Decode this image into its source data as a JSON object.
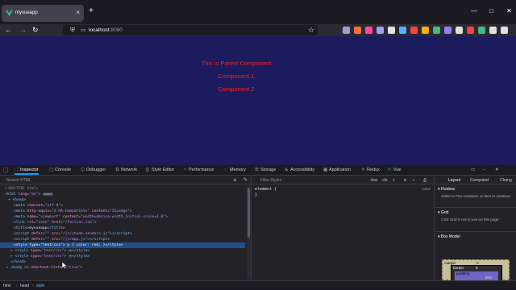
{
  "browser": {
    "tab_title": "myvueapp",
    "tab_close": "×",
    "new_tab": "+",
    "window_controls": [
      "—",
      "□",
      "✕"
    ],
    "nav": {
      "back": "←",
      "forward": "→",
      "reload": "↻"
    },
    "url_host": "localhost",
    "url_port": ":8080",
    "bookmark_star": "☆",
    "extension_colors": [
      "#9f9fd0",
      "#ff7139",
      "#ff45a8",
      "#a0a0f0",
      "#e0e0e0",
      "#4fb3ff",
      "#ff4040",
      "#ffb000",
      "#42b883",
      "#9a7bff",
      "#e0e0e0",
      "#ff4040",
      "#42b883",
      "#e0e0e0",
      "#e0e0e0"
    ]
  },
  "page": {
    "lines": [
      "This is Parent Component",
      "Component 1",
      "Component 2"
    ],
    "background": "#1b1b5e",
    "text_color": "#ff1f1f"
  },
  "devtools": {
    "tabs": [
      {
        "icon": "⬚",
        "label": "Inspector"
      },
      {
        "icon": "▢",
        "label": "Console"
      },
      {
        "icon": "⬡",
        "label": "Debugger"
      },
      {
        "icon": "⇅",
        "label": "Network"
      },
      {
        "icon": "{}",
        "label": "Style Editor"
      },
      {
        "icon": "◔",
        "label": "Performance"
      },
      {
        "icon": "◌",
        "label": "Memory"
      },
      {
        "icon": "☰",
        "label": "Storage"
      },
      {
        "icon": "♿",
        "label": "Accessibility"
      },
      {
        "icon": "▦",
        "label": "Application"
      },
      {
        "icon": "⚛",
        "label": "Redux"
      },
      {
        "icon": "V",
        "label": "Vue"
      }
    ],
    "html_search_placeholder": "Search HTML",
    "add_node": "+",
    "picker": "✎",
    "breadcrumb": [
      "html",
      "head",
      "style"
    ],
    "rules": {
      "filter_placeholder": "Filter Styles",
      "options": [
        ":hov",
        ".cls",
        "+"
      ],
      "element_rule": "element {",
      "element_close": "}",
      "source": "inline"
    },
    "layout": {
      "tabs": [
        "Layout",
        "Computed",
        "Chang"
      ],
      "flexbox_title": "Flexbox",
      "flexbox_note": "Select a Flex container or item to continue.",
      "grid_title": "Grid",
      "grid_note": "CSS Grid is not in use on this page",
      "boxmodel_title": "Box Model",
      "bm_margin": "margin",
      "bm_border": "border",
      "bm_padding": "padding",
      "bm_zero": "0"
    }
  }
}
